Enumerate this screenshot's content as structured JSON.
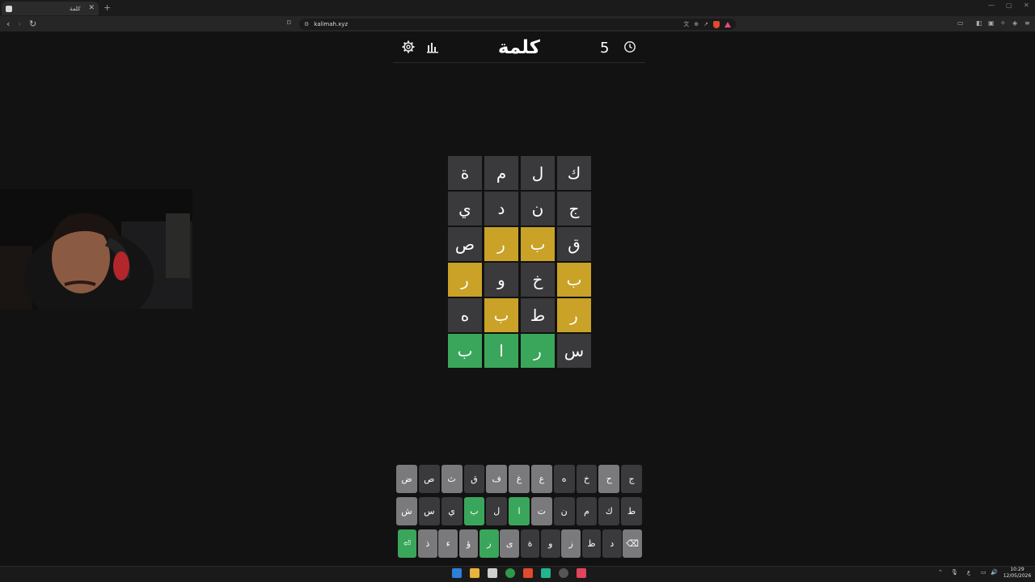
{
  "browser": {
    "tab_title": "كلمة",
    "tab_close": "✕",
    "new_tab": "+",
    "url": "kalimah.xyz",
    "window_controls": [
      "—",
      "▢",
      "✕"
    ]
  },
  "game": {
    "title": "كلمة",
    "streak": "5",
    "icons": {
      "settings": "gear-icon",
      "stats": "bar-chart-icon",
      "help": "clock-help-icon"
    }
  },
  "board": {
    "rows": [
      [
        {
          "letter": "ك",
          "state": "absent"
        },
        {
          "letter": "ل",
          "state": "absent"
        },
        {
          "letter": "م",
          "state": "absent"
        },
        {
          "letter": "ة",
          "state": "absent"
        }
      ],
      [
        {
          "letter": "ج",
          "state": "absent"
        },
        {
          "letter": "ن",
          "state": "absent"
        },
        {
          "letter": "د",
          "state": "absent"
        },
        {
          "letter": "ي",
          "state": "absent"
        }
      ],
      [
        {
          "letter": "ق",
          "state": "absent"
        },
        {
          "letter": "ب",
          "state": "present"
        },
        {
          "letter": "ر",
          "state": "present"
        },
        {
          "letter": "ص",
          "state": "absent"
        }
      ],
      [
        {
          "letter": "ب",
          "state": "present"
        },
        {
          "letter": "خ",
          "state": "absent"
        },
        {
          "letter": "و",
          "state": "absent"
        },
        {
          "letter": "ر",
          "state": "present"
        }
      ],
      [
        {
          "letter": "ر",
          "state": "present"
        },
        {
          "letter": "ط",
          "state": "absent"
        },
        {
          "letter": "ب",
          "state": "present"
        },
        {
          "letter": "ه",
          "state": "absent"
        }
      ],
      [
        {
          "letter": "س",
          "state": "absent"
        },
        {
          "letter": "ر",
          "state": "correct"
        },
        {
          "letter": "ا",
          "state": "correct"
        },
        {
          "letter": "ب",
          "state": "correct"
        }
      ]
    ],
    "colors": {
      "absent": "#3a3a3c",
      "present": "#c9a227",
      "correct": "#3aa65b"
    }
  },
  "keyboard": {
    "rows": [
      [
        {
          "key": "ج",
          "state": "default"
        },
        {
          "key": "ح",
          "state": "used"
        },
        {
          "key": "خ",
          "state": "default"
        },
        {
          "key": "ه",
          "state": "default"
        },
        {
          "key": "ع",
          "state": "used"
        },
        {
          "key": "غ",
          "state": "used"
        },
        {
          "key": "ف",
          "state": "used"
        },
        {
          "key": "ق",
          "state": "default"
        },
        {
          "key": "ث",
          "state": "used"
        },
        {
          "key": "ص",
          "state": "default"
        },
        {
          "key": "ض",
          "state": "used"
        }
      ],
      [
        {
          "key": "ط",
          "state": "default"
        },
        {
          "key": "ك",
          "state": "default"
        },
        {
          "key": "م",
          "state": "default"
        },
        {
          "key": "ن",
          "state": "default"
        },
        {
          "key": "ت",
          "state": "used"
        },
        {
          "key": "ا",
          "state": "correct"
        },
        {
          "key": "ل",
          "state": "default"
        },
        {
          "key": "ب",
          "state": "correct"
        },
        {
          "key": "ي",
          "state": "default"
        },
        {
          "key": "س",
          "state": "default"
        },
        {
          "key": "ش",
          "state": "used"
        }
      ],
      [
        {
          "key": "⌫",
          "state": "used"
        },
        {
          "key": "د",
          "state": "default"
        },
        {
          "key": "ظ",
          "state": "default"
        },
        {
          "key": "ز",
          "state": "used"
        },
        {
          "key": "و",
          "state": "default"
        },
        {
          "key": "ة",
          "state": "default"
        },
        {
          "key": "ى",
          "state": "used"
        },
        {
          "key": "ر",
          "state": "correct"
        },
        {
          "key": "ؤ",
          "state": "used"
        },
        {
          "key": "ء",
          "state": "used"
        },
        {
          "key": "ذ",
          "state": "used"
        },
        {
          "key": "⏎",
          "state": "correct"
        }
      ]
    ]
  },
  "taskbar": {
    "time": "10:29",
    "date": "12/05/2026",
    "tray_lang": "ع"
  }
}
